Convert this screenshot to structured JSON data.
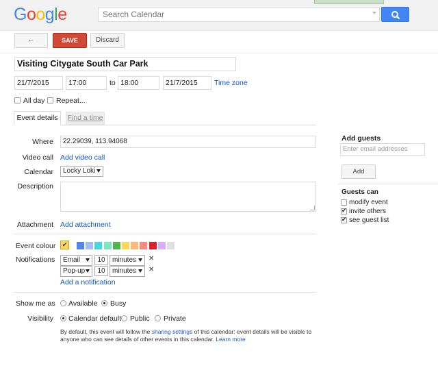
{
  "header": {
    "logo_letters": [
      {
        "ch": "G",
        "color": "#4285f4"
      },
      {
        "ch": "o",
        "color": "#ea4335"
      },
      {
        "ch": "o",
        "color": "#fbbc05"
      },
      {
        "ch": "g",
        "color": "#4285f4"
      },
      {
        "ch": "l",
        "color": "#34a853"
      },
      {
        "ch": "e",
        "color": "#ea4335"
      }
    ],
    "search_placeholder": "Search Calendar"
  },
  "toolbar": {
    "back_label": "←",
    "save_label": "SAVE",
    "discard_label": "Discard"
  },
  "event": {
    "title": "Visiting Citygate South Car Park",
    "start_date": "21/7/2015",
    "start_time": "17:00",
    "to_label": "to",
    "end_time": "18:00",
    "end_date": "21/7/2015",
    "timezone_link": "Time zone",
    "all_day_label": "All day",
    "repeat_label": "Repeat..."
  },
  "tabs": {
    "details": "Event details",
    "find_time": "Find a time"
  },
  "details": {
    "where_label": "Where",
    "where_value": "22.29039, 113.94068",
    "video_label": "Video call",
    "video_link": "Add video call",
    "calendar_label": "Calendar",
    "calendar_value": "Locky Loki",
    "description_label": "Description",
    "attachment_label": "Attachment",
    "attachment_link": "Add attachment",
    "colour_label": "Event colour",
    "colours": [
      "#5484ed",
      "#a4bdfc",
      "#46d6db",
      "#7ae7bf",
      "#51b749",
      "#fbd75b",
      "#ffb878",
      "#ff887c",
      "#dc2127",
      "#dbadff",
      "#e1e1e1"
    ],
    "notifications_label": "Notifications",
    "notifications": [
      {
        "method": "Email",
        "amount": "10",
        "unit": "minutes"
      },
      {
        "method": "Pop-up",
        "amount": "10",
        "unit": "minutes"
      }
    ],
    "add_notification": "Add a notification",
    "show_me_as_label": "Show me as",
    "available_label": "Available",
    "busy_label": "Busy",
    "visibility_label": "Visibility",
    "vis_default": "Calendar default",
    "vis_public": "Public",
    "vis_private": "Private",
    "footnote_pre": "By default, this event will follow the ",
    "footnote_link": "sharing settings",
    "footnote_mid": " of this calendar: event details will be visible to anyone who can see details of other events in this calendar. ",
    "footnote_more": "Learn more"
  },
  "guests": {
    "title": "Add guests",
    "input_placeholder": "Enter email addresses",
    "add_label": "Add",
    "guests_can": "Guests can",
    "modify": "modify event",
    "invite": "invite others",
    "see_list": "see guest list"
  }
}
